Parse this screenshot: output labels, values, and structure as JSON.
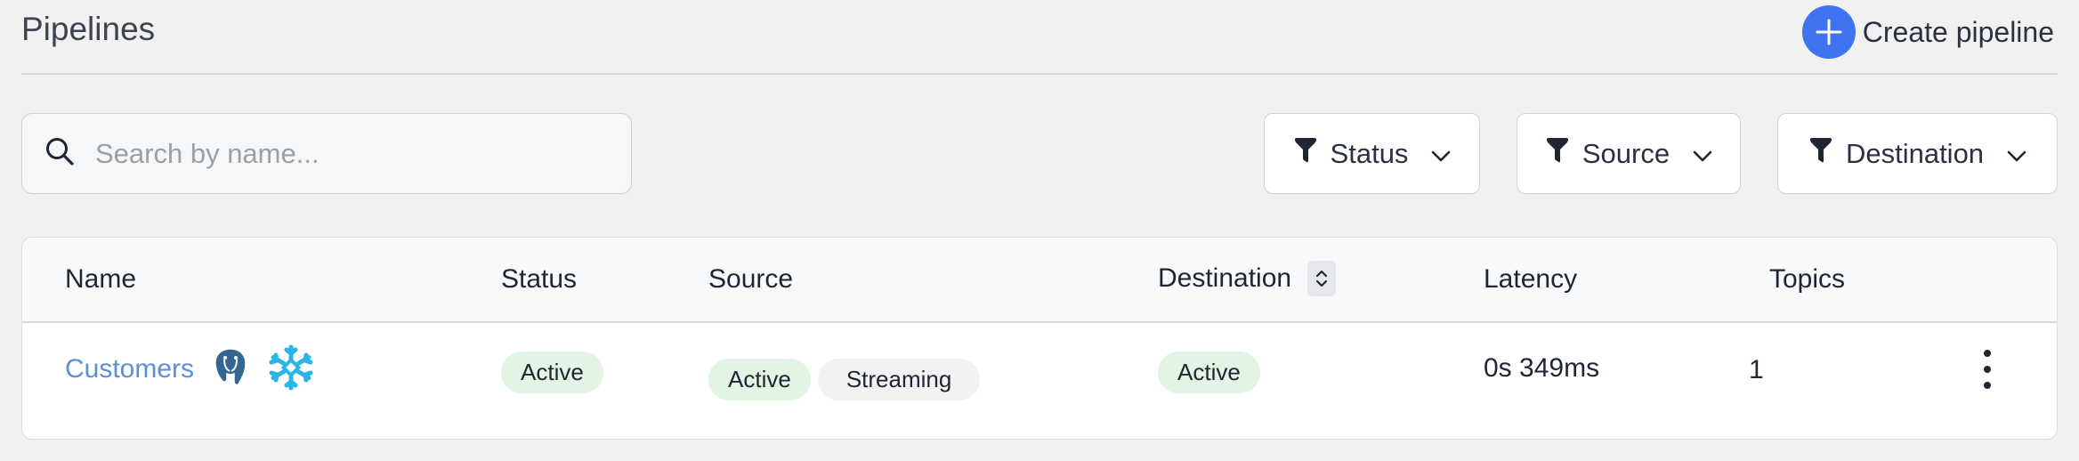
{
  "header": {
    "title": "Pipelines",
    "create_label": "Create pipeline",
    "accent_color": "#3f73ef"
  },
  "search": {
    "placeholder": "Search by name...",
    "value": "",
    "icon": "search-icon"
  },
  "filters": [
    {
      "label": "Status",
      "icon": "filter-icon"
    },
    {
      "label": "Source",
      "icon": "filter-icon"
    },
    {
      "label": "Destination",
      "icon": "filter-icon"
    }
  ],
  "table": {
    "columns": [
      "Name",
      "Status",
      "Source",
      "Destination",
      "Latency",
      "Topics"
    ],
    "rows": [
      {
        "name": "Customers",
        "source_icons": [
          "postgres-icon",
          "snowflake-icon"
        ],
        "status": "Active",
        "source_status": "Active",
        "source_mode": "Streaming",
        "destination_status": "Active",
        "latency": "0s 349ms",
        "topics": "1"
      }
    ]
  },
  "colors": {
    "badge_active_bg": "#e2f4e3",
    "link": "#5b8fd9"
  }
}
